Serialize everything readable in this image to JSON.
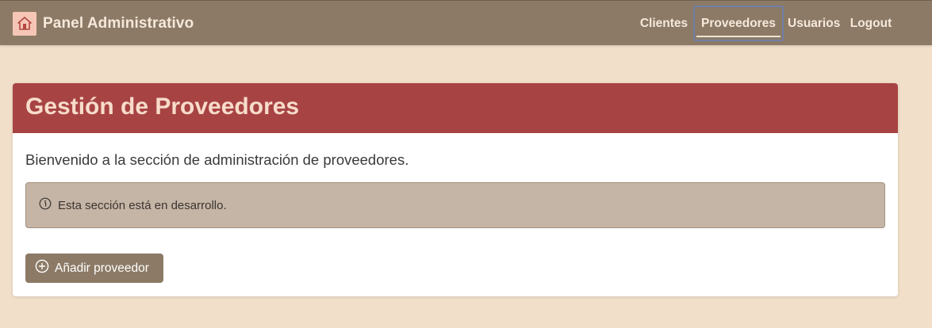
{
  "navbar": {
    "brand": "Panel Administrativo",
    "links": [
      "Clientes",
      "Proveedores",
      "Usuarios",
      "Logout"
    ],
    "active": "Proveedores"
  },
  "page": {
    "title": "Gestión de Proveedores",
    "intro": "Bienvenido a la sección de administración de proveedores.",
    "alert": "Esta sección está en desarrollo.",
    "add_button": "Añadir proveedor"
  },
  "colors": {
    "navbar": "#8c7a66",
    "background": "#f1dfca",
    "header": "#a84343",
    "alert": "#c5b5a6",
    "button": "#8c7a66"
  },
  "icons": {
    "brand": "house-icon",
    "alert": "info-circle-icon",
    "add_button": "plus-circle-icon"
  }
}
